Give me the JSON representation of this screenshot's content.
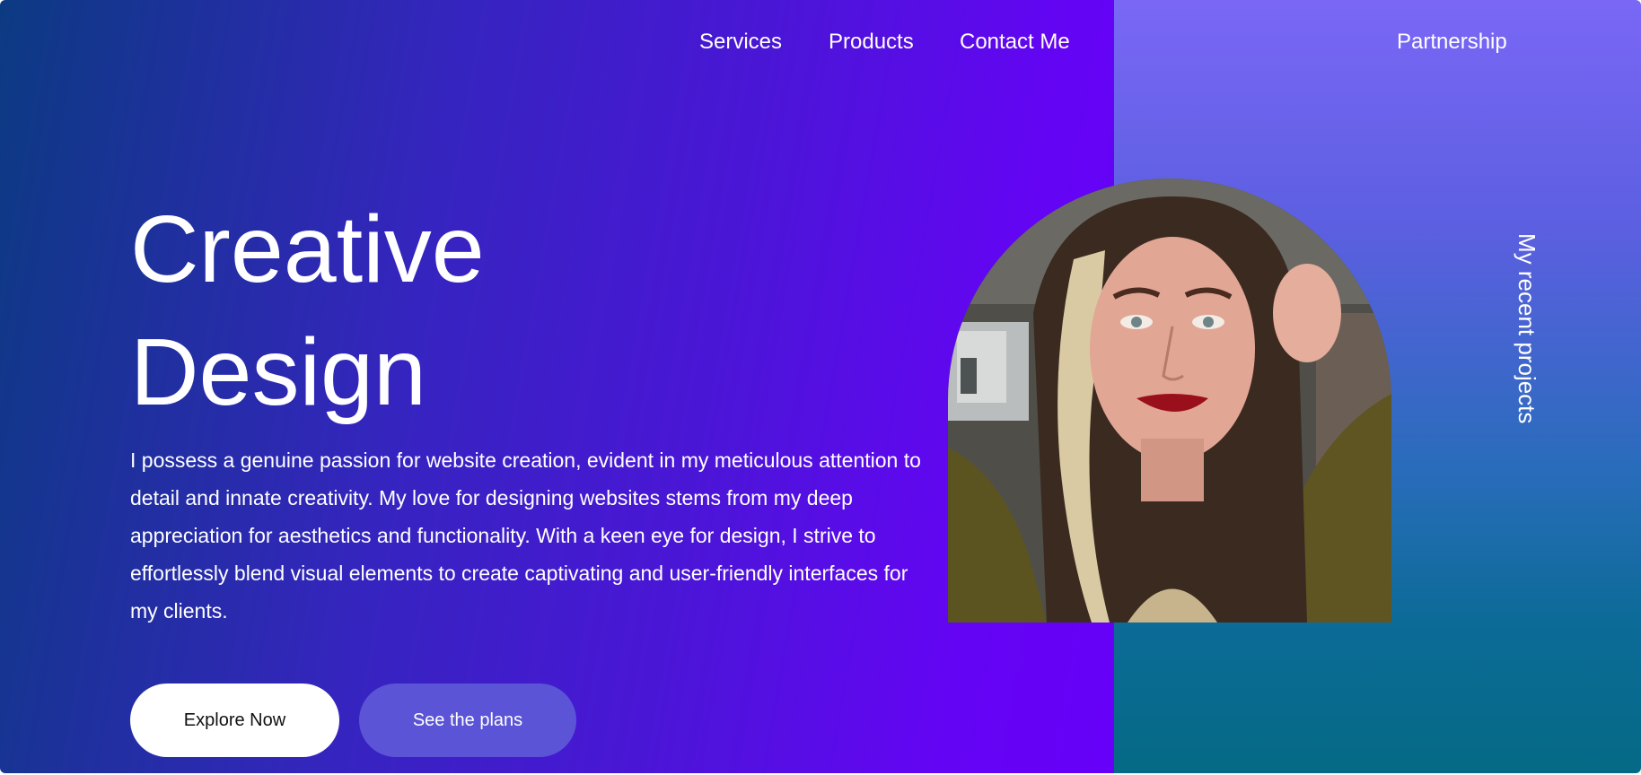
{
  "nav": {
    "services": "Services",
    "products": "Products",
    "contact": "Contact Me",
    "partnership": "Partnership"
  },
  "hero": {
    "title_line1": "Creative",
    "title_line2": "Design",
    "description": "I possess a genuine passion for website creation, evident in my meticulous attention to detail and innate creativity. My love for designing websites stems from my deep appreciation for aesthetics and functionality. With a keen eye for design, I strive to effortlessly blend visual elements to create captivating and user-friendly interfaces for my clients.",
    "primary_button": "Explore Now",
    "secondary_button": "See the plans"
  },
  "side": {
    "vertical_label": "My recent projects"
  },
  "colors": {
    "gradient_start": "#0c3a82",
    "gradient_end": "#6600f8",
    "right_panel_top": "#7a67f6",
    "right_panel_bottom": "#046a85",
    "secondary_button": "#5b54d6",
    "primary_button": "#ffffff"
  }
}
